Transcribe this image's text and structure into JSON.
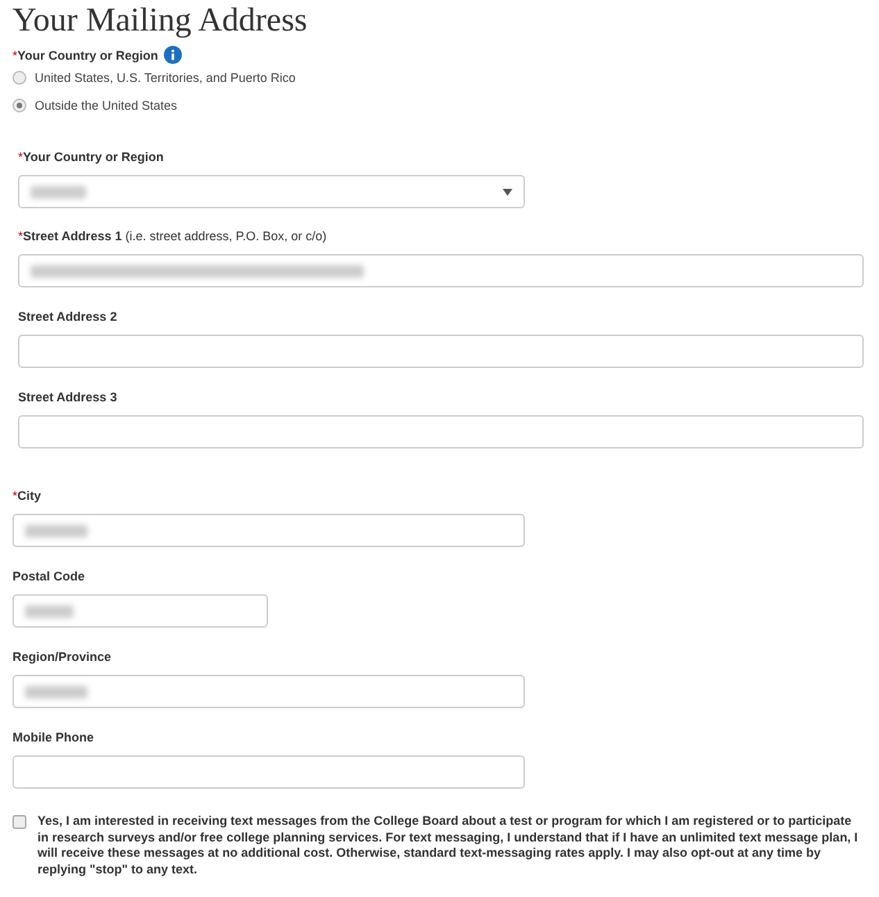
{
  "title": "Your Mailing Address",
  "residence": {
    "label": "Your Country or Region",
    "required_mark": "*",
    "options": [
      {
        "label": "United States, U.S. Territories, and Puerto Rico",
        "selected": false
      },
      {
        "label": "Outside the United States",
        "selected": true
      }
    ]
  },
  "fields": [
    {
      "kind": "select",
      "required_mark": "*",
      "label": "Your Country or Region",
      "redacted": true
    },
    {
      "kind": "text",
      "required_mark": "*",
      "label": "Street Address 1",
      "hint": "(i.e. street address, P.O. Box, or c/o)",
      "redacted": true
    },
    {
      "kind": "text",
      "label": "Street Address 2",
      "redacted": false
    },
    {
      "kind": "text",
      "label": "Street Address 3",
      "redacted": false
    },
    {
      "kind": "text",
      "required_mark": "*",
      "label": "City",
      "redacted": true
    },
    {
      "kind": "text",
      "label": "Postal Code",
      "redacted": true
    },
    {
      "kind": "text",
      "label": "Region/Province",
      "redacted": true
    },
    {
      "kind": "text",
      "label": "Mobile Phone",
      "redacted": false
    }
  ],
  "consent": {
    "checked": false,
    "text": "Yes, I am interested in receiving text messages from the College Board about a test or program for which I am registered or to participate in research surveys and/or free college planning services. For text messaging, I understand that if I have an unlimited text message plan, I will receive these messages at no additional cost. Otherwise, standard text-messaging rates apply. I may also opt-out at any time by replying \"stop\" to any text."
  }
}
